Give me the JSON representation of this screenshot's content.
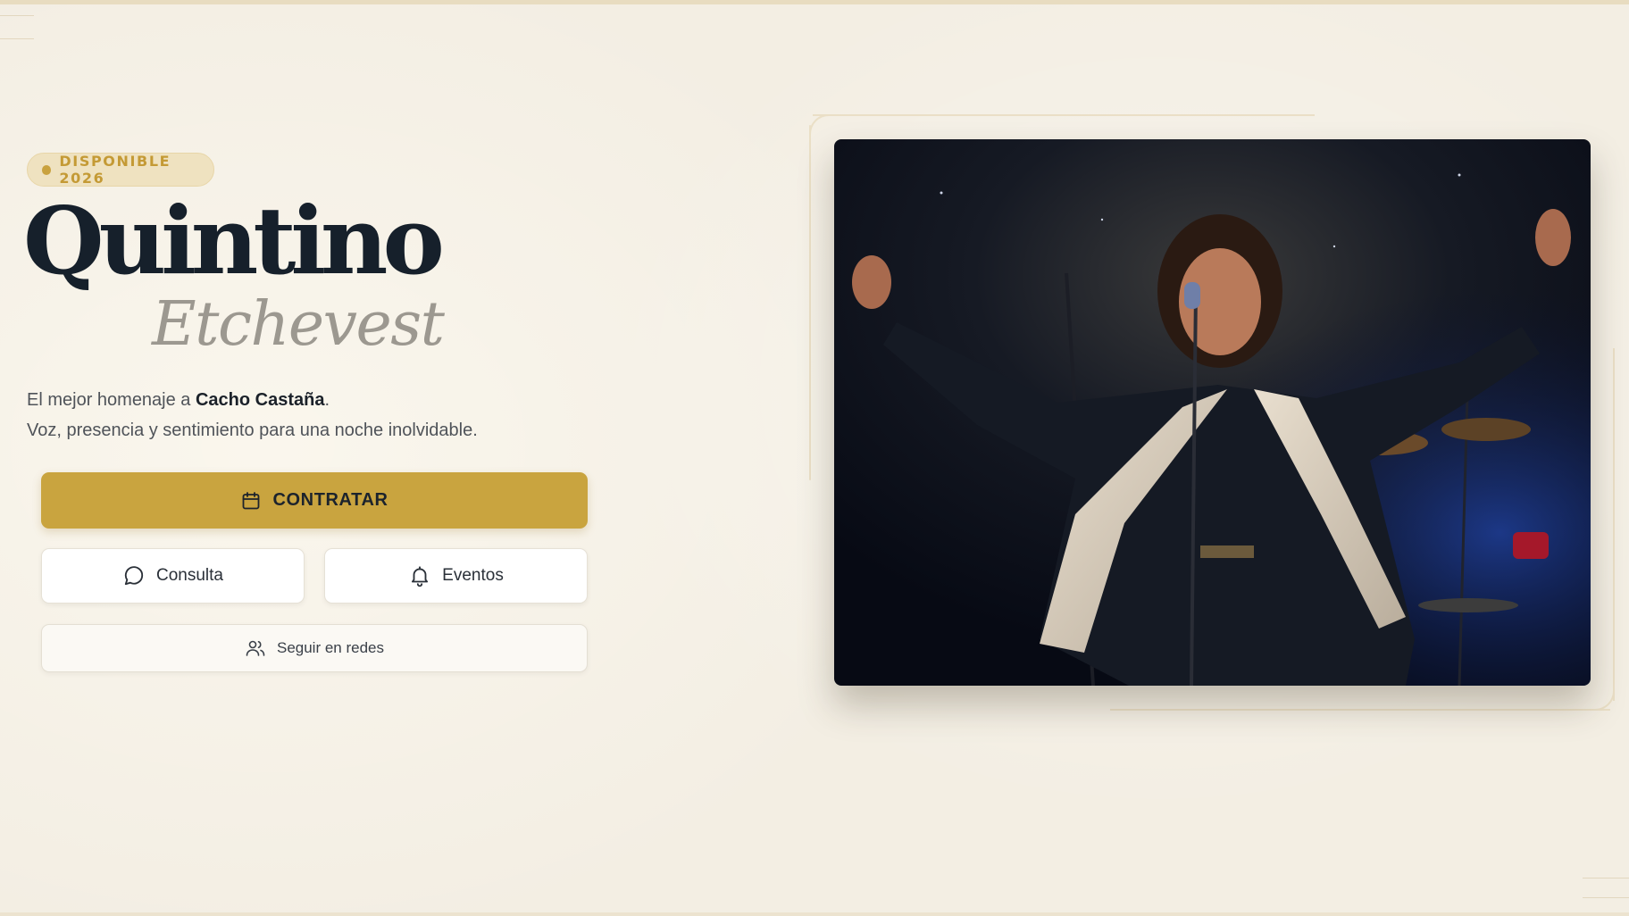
{
  "hero": {
    "badge_text": "DISPONIBLE 2026",
    "title_main": "Quintino",
    "title_sub": "Etchevest",
    "tagline_prefix": "El mejor homenaje a ",
    "tagline_highlight": "Cacho Castaña",
    "tagline_suffix": ".",
    "tagline_line2": "Voz, presencia y sentimiento para una noche inolvidable."
  },
  "actions": {
    "primary": {
      "label": "CONTRATAR",
      "icon": "calendar-icon"
    },
    "consulta": {
      "label": "Consulta",
      "icon": "chat-bubble-icon"
    },
    "eventos": {
      "label": "Eventos",
      "icon": "bell-icon"
    },
    "redes": {
      "label": "Seguir en redes",
      "icon": "users-icon"
    }
  },
  "colors": {
    "background": "#f3eee3",
    "accent_gold": "#c9a43f",
    "title_dark": "#16202b",
    "title_muted": "#9c9890"
  },
  "photo": {
    "subject": "singer-on-stage-photo"
  }
}
